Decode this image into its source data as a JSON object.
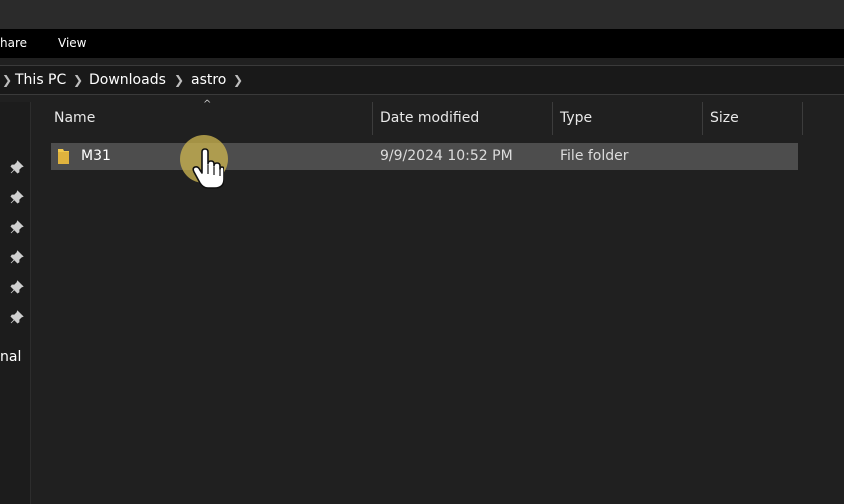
{
  "ribbon": {
    "tabs": [
      {
        "label": "hare"
      },
      {
        "label": "View"
      }
    ]
  },
  "address": {
    "crumbs": [
      {
        "label": "This PC"
      },
      {
        "label": "Downloads"
      },
      {
        "label": "astro"
      }
    ]
  },
  "nav_pane": {
    "pins": [
      "pin-icon",
      "pin-icon",
      "pin-icon",
      "pin-icon",
      "pin-icon",
      "pin-icon"
    ],
    "bottom_label": "nal"
  },
  "columns": {
    "name": "Name",
    "date_modified": "Date modified",
    "type": "Type",
    "size": "Size",
    "sort_indicator": "^"
  },
  "files": [
    {
      "name": "M31",
      "date_modified": "9/9/2024 10:52 PM",
      "type": "File folder",
      "size": "",
      "icon": "folder-icon",
      "selected": true
    }
  ],
  "colors": {
    "background": "#202020",
    "ribbon": "#000000",
    "selected_row": "#4d4d4d",
    "folder": "#f2c94c",
    "cursor_highlight": "#c9b250"
  }
}
